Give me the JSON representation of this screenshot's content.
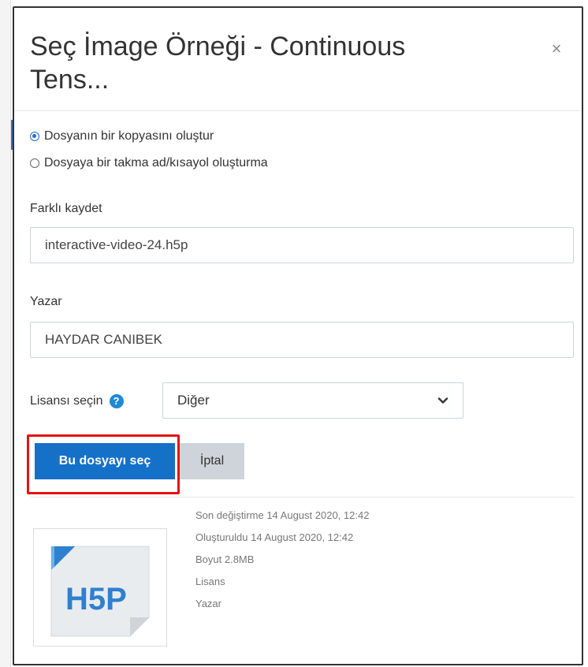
{
  "dialog": {
    "title": "Seç İmage Örneği - Continuous Tens...",
    "close_symbol": "×"
  },
  "options": {
    "copy_label": "Dosyanın bir kopyasını oluştur",
    "alias_label": "Dosyaya bir takma ad/kısayol oluşturma",
    "selected": "copy"
  },
  "save_as": {
    "label": "Farklı kaydet",
    "value": "interactive-video-24.h5p"
  },
  "author": {
    "label": "Yazar",
    "value": "HAYDAR CANIBEK"
  },
  "license": {
    "label": "Lisansı seçin",
    "help_symbol": "?",
    "selected": "Diğer"
  },
  "buttons": {
    "select_label": "Bu dosyayı seç",
    "cancel_label": "İptal"
  },
  "file_info": {
    "modified": "Son değiştirme  14 August 2020, 12:42",
    "created": "Oluşturuldu  14 August 2020, 12:42",
    "size": "Boyut  2.8MB",
    "license": "Lisans",
    "author": "Yazar"
  },
  "thumbnail": {
    "logo_text": "H5P",
    "icon": "h5p-file-icon"
  },
  "colors": {
    "primary": "#1570c8",
    "highlight": "#e31313",
    "h5p_blue": "#2f80cf"
  }
}
